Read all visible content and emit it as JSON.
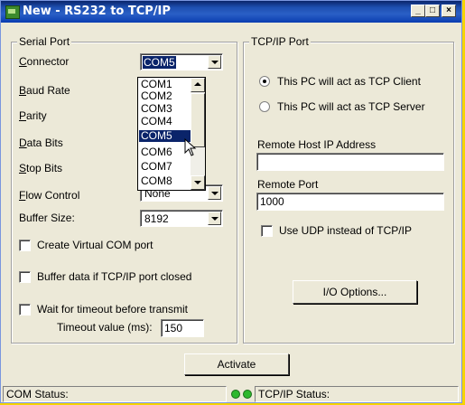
{
  "window": {
    "title": "New - RS232 to TCP/IP",
    "minimize": "_",
    "maximize": "□",
    "close": "×"
  },
  "serial": {
    "group_label": "Serial Port",
    "connector_label_u": "C",
    "connector_label_rest": "onnector",
    "connector_value": "COM5",
    "baud_label_u": "B",
    "baud_label_rest": "aud Rate",
    "parity_label_u": "P",
    "parity_label_rest": "arity",
    "databits_label_u": "D",
    "databits_label_rest": "ata Bits",
    "stopbits_label_u": "S",
    "stopbits_label_rest": "top Bits",
    "flow_label_u": "F",
    "flow_label_rest": "low Control",
    "flow_value": "None",
    "buffer_label": "Buffer Size:",
    "buffer_value": "8192",
    "dropdown_items": [
      "COM1",
      "COM2",
      "COM3",
      "COM4",
      "COM5",
      "COM6",
      "COM7",
      "COM8"
    ],
    "dropdown_selected_index": 4
  },
  "options": {
    "virtual_com": "Create Virtual COM port",
    "buffer_closed": "Buffer data if TCP/IP port closed",
    "wait_timeout": "Wait for timeout before transmit",
    "timeout_label": "Timeout value (ms):",
    "timeout_value": "150"
  },
  "tcp": {
    "group_label": "TCP/IP Port",
    "client_radio": "This PC will act as TCP Client",
    "server_radio": "This PC will act as TCP Server",
    "remote_host_label": "Remote Host IP Address",
    "remote_host_value": "",
    "remote_port_label": "Remote Port",
    "remote_port_value": "1000",
    "udp_checkbox": "Use UDP instead of TCP/IP",
    "io_options_button": "I/O Options..."
  },
  "actions": {
    "activate_button": "Activate"
  },
  "status": {
    "com_status": "COM Status:",
    "tcp_status": "TCP/IP Status:",
    "led_color": "#2eb82e"
  }
}
